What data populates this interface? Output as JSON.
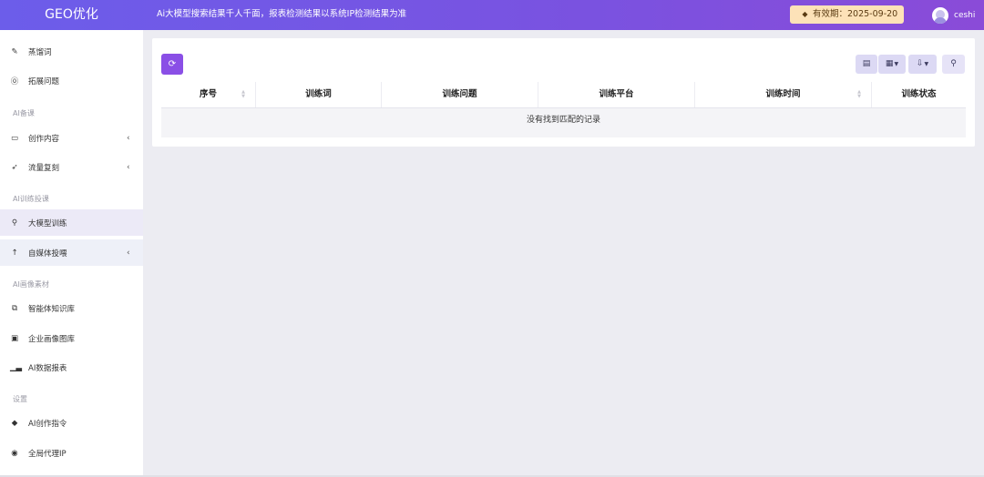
{
  "header": {
    "logo": "GEO优化",
    "notice": "Ai大模型搜索结果千人千面，报表检测结果以系统IP检测结果为准",
    "validity_icon": "diamond-icon",
    "validity_label": "有效期：2025-09-20",
    "username": "ceshi"
  },
  "sidebar": {
    "items": [
      {
        "label": "蒸馏词",
        "icon": "tag-icon"
      },
      {
        "label": "拓展问题",
        "icon": "question-circle-icon"
      },
      {
        "label": "创作内容",
        "icon": "folder-open-icon",
        "chevron": "‹"
      },
      {
        "label": "流量复刻",
        "icon": "rocket-icon",
        "chevron": "‹"
      },
      {
        "label": "大模型训练",
        "icon": "search-icon"
      },
      {
        "label": "自媒体投喂",
        "icon": "arrow-up-icon",
        "chevron": "‹"
      },
      {
        "label": "智能体知识库",
        "icon": "copy-icon"
      },
      {
        "label": "企业画像图库",
        "icon": "image-icon"
      },
      {
        "label": "AI数据报表",
        "icon": "bar-chart-icon"
      },
      {
        "label": "AI创作指令",
        "icon": "tag-filled-icon"
      },
      {
        "label": "全局代理IP",
        "icon": "chrome-icon"
      }
    ],
    "sections": [
      "AI备课",
      "AI训练投课",
      "AI画像素材",
      "设置"
    ]
  },
  "toolbar": {
    "refresh_icon": "refresh-icon",
    "toggle_icon": "list-toggle-icon",
    "columns_icon": "columns-grid-icon",
    "export_icon": "export-icon",
    "search_icon": "search-icon"
  },
  "table": {
    "columns": [
      "序号",
      "训练词",
      "训练问题",
      "训练平台",
      "训练时间",
      "训练状态"
    ],
    "empty_text": "没有找到匹配的记录"
  },
  "colors": {
    "header_gradient_start": "#6c5dea",
    "header_gradient_end": "#8a4bd8",
    "accent": "#8a4fe6",
    "validity_bg": "#fde2b8"
  }
}
